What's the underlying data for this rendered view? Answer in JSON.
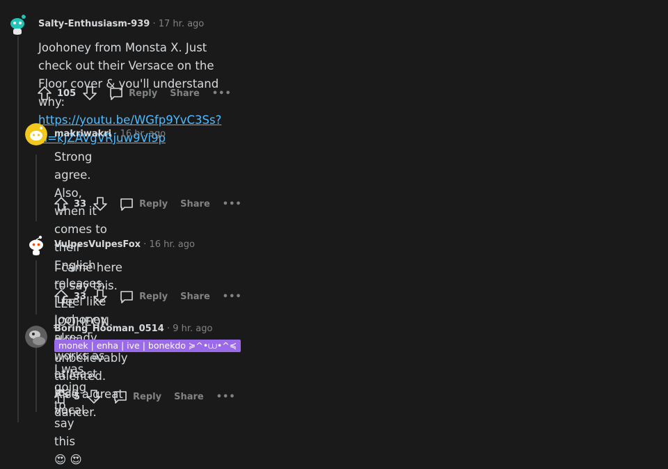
{
  "comments": [
    {
      "username": "Salty-Enthusiasm-939",
      "time": "17 hr. ago",
      "text": "Joohoney from Monsta X. Just check out their Versace on the Floor cover & you'll understand why:",
      "link": "https://youtu.be/WGfp9YvC3Ss?si=kJZAVgVRjuw9Vi9p",
      "votes": "105",
      "reply_label": "Reply",
      "share_label": "Share",
      "more_label": "•••",
      "avatar_color": "#23c3b6"
    },
    {
      "username": "makriwakri",
      "time": "16 hr. ago",
      "text_line1": "Strong agree. Also, when it comes to their English releases, I feel like Joohoney already works as at least lead",
      "text_line2": "vocal.",
      "votes": "33",
      "reply_label": "Reply",
      "share_label": "Share",
      "more_label": "•••",
      "avatar_color": "#f2c81c"
    },
    {
      "username": "VulpesVulpesFox",
      "time": "16 hr. ago",
      "text": "I came here to say this. LEE JOOHEON. He's unbelievably talented. Also a great dancer.",
      "votes": "33",
      "reply_label": "Reply",
      "share_label": "Share",
      "more_label": "•••",
      "avatar_color": "#1a1a1b"
    },
    {
      "username": "Boring_Hooman_0514",
      "time": "9 hr. ago",
      "flair": "monek | enha | ive | bonekdo ≽^•⩊•^≼",
      "text": "I was going to say this 😍 😍",
      "votes": "5",
      "reply_label": "Reply",
      "share_label": "Share",
      "more_label": "•••",
      "avatar_color": "#7a7a7a"
    }
  ],
  "separator": "·",
  "colors": {
    "background": "#1a1a1b",
    "text": "#d7dadc",
    "muted": "#818384",
    "link": "#4fbcff",
    "flair": "#9b6ae8"
  }
}
